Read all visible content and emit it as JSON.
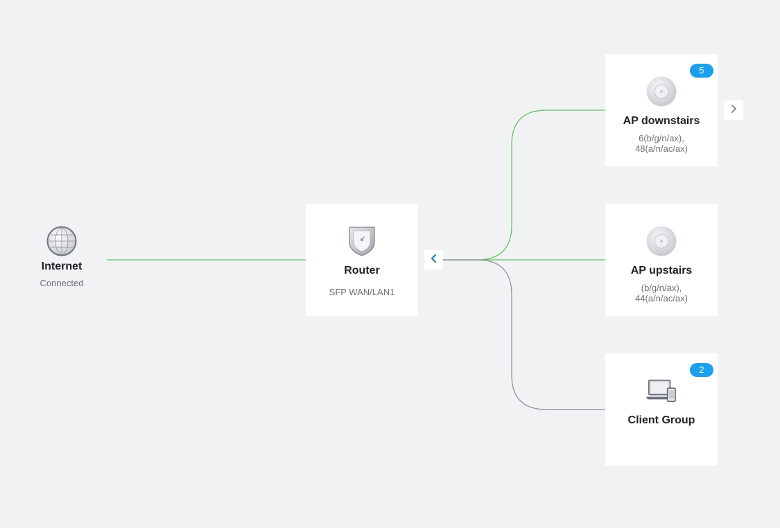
{
  "colors": {
    "background": "#f1f2f4",
    "link_active": "#5cc25c",
    "link_inactive": "#8a8d92",
    "badge": "#1aa0f0",
    "accent": "#1a7fd6"
  },
  "internet": {
    "icon": "globe-icon",
    "title": "Internet",
    "status": "Connected"
  },
  "router": {
    "icon": "shield-router-icon",
    "title": "Router",
    "port": "SFP WAN/LAN1"
  },
  "devices": [
    {
      "icon": "access-point-icon",
      "title": "AP downstairs",
      "channels": "6(b/g/n/ax), 48(a/n/ac/ax)",
      "badge": "5",
      "link_status": "active"
    },
    {
      "icon": "access-point-icon",
      "title": "AP upstairs",
      "channels": "(b/g/n/ax), 44(a/n/ac/ax)",
      "badge": "",
      "link_status": "active"
    },
    {
      "icon": "laptop-phone-icon",
      "title": "Client Group",
      "channels": "",
      "badge": "2",
      "link_status": "inactive"
    }
  ],
  "controls": {
    "collapse_icon": "chevron-left-icon",
    "expand_icon": "chevron-right-icon"
  }
}
